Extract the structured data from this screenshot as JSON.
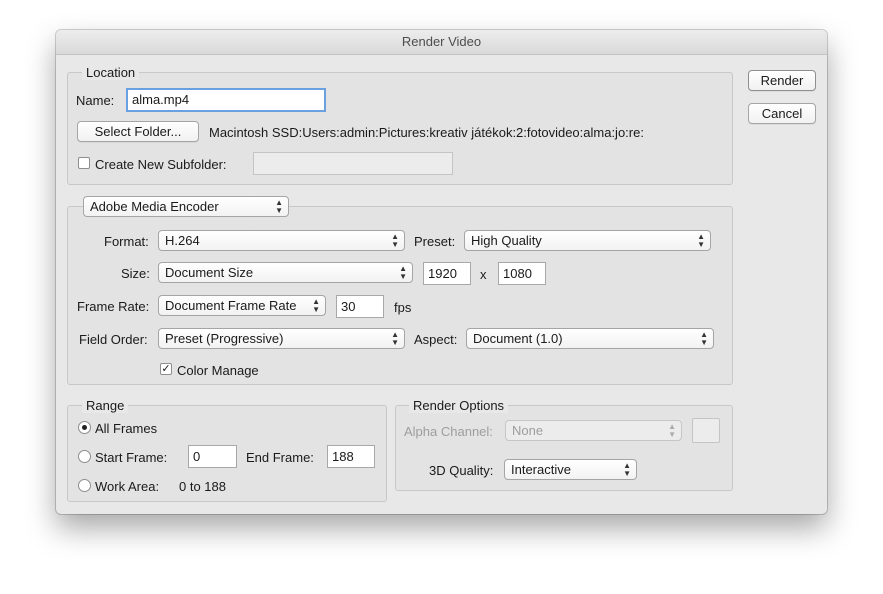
{
  "window": {
    "title": "Render Video"
  },
  "buttons": {
    "render": "Render",
    "cancel": "Cancel"
  },
  "location": {
    "legend": "Location",
    "name_label": "Name:",
    "name_value": "alma.mp4",
    "select_folder_label": "Select Folder...",
    "path": "Macintosh SSD:Users:admin:Pictures:kreativ játékok:2:fotovideo:alma:jo:re:",
    "create_subfolder_label": "Create New Subfolder:",
    "create_subfolder_checked": false,
    "subfolder_value": ""
  },
  "encoder": {
    "selected": "Adobe Media Encoder",
    "format_label": "Format:",
    "format_value": "H.264",
    "preset_label": "Preset:",
    "preset_value": "High Quality",
    "size_label": "Size:",
    "size_value": "Document Size",
    "width": "1920",
    "x_sep": "x",
    "height": "1080",
    "frame_rate_label": "Frame Rate:",
    "frame_rate_value": "Document Frame Rate",
    "fps_value": "30",
    "fps_unit": "fps",
    "field_order_label": "Field Order:",
    "field_order_value": "Preset (Progressive)",
    "aspect_label": "Aspect:",
    "aspect_value": "Document (1.0)",
    "color_manage_label": "Color Manage",
    "color_manage_checked": true
  },
  "range": {
    "legend": "Range",
    "all_frames_label": "All Frames",
    "all_frames_selected": true,
    "start_frame_label": "Start Frame:",
    "start_frame_value": "0",
    "end_frame_label": "End Frame:",
    "end_frame_value": "188",
    "work_area_label": "Work Area:",
    "work_area_value": "0 to 188"
  },
  "render_options": {
    "legend": "Render Options",
    "alpha_label": "Alpha Channel:",
    "alpha_value": "None",
    "quality_label": "3D Quality:",
    "quality_value": "Interactive"
  },
  "icons": {
    "stepper": "up-down-arrows-icon",
    "check": "✓"
  }
}
